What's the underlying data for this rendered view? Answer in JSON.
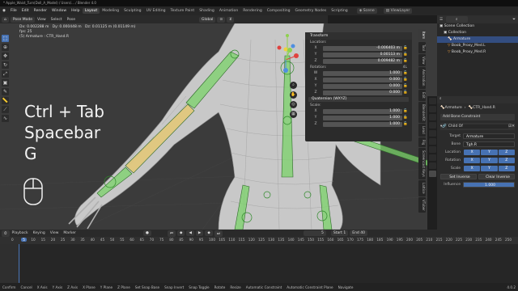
{
  "titlebar": {
    "text": "* Apple_Waist_Turn(Doll_A_Model) / Users/... / Blender 4.0"
  },
  "menubar": {
    "menus": [
      "File",
      "Edit",
      "Render",
      "Window",
      "Help"
    ],
    "workspaces": [
      "Layout",
      "Modeling",
      "Sculpting",
      "UV Editing",
      "Texture Paint",
      "Shading",
      "Animation",
      "Rendering",
      "Compositing",
      "Geometry Nodes",
      "Scripting"
    ],
    "active_workspace": "Layout",
    "scene": "Scene",
    "view_layer": "ViewLayer"
  },
  "viewport_header": {
    "mode": "Pose Mode",
    "menus": [
      "View",
      "Select",
      "Pose"
    ],
    "orientation": "Global"
  },
  "viewport": {
    "info_line1": "Dx: 0.002288 m   Dy: 0.000448 m   Dz: 0.01125 m (0.01149 m)",
    "info_line2": "fps: 25",
    "info_line3": "(5) Armature : CTR_Hand.R"
  },
  "overlay_text": {
    "line1": "Ctrl + Tab",
    "line2": "Spacebar",
    "line3": "G"
  },
  "npanel": {
    "transform_title": "Transform",
    "location_label": "Location:",
    "location": [
      {
        "axis": "X",
        "value": "-0.006403 m"
      },
      {
        "axis": "Y",
        "value": "0.00113 m"
      },
      {
        "axis": "Z",
        "value": "0.009482 m"
      }
    ],
    "rotation_label": "Rotation:",
    "rotation_mode": "4L",
    "rotation": [
      {
        "axis": "W",
        "value": "1.000"
      },
      {
        "axis": "X",
        "value": "0.000"
      },
      {
        "axis": "Y",
        "value": "0.000"
      },
      {
        "axis": "Z",
        "value": "0.000"
      }
    ],
    "rotation_type": "Quaternion (WXYZ)",
    "scale_label": "Scale:",
    "scale": [
      {
        "axis": "X",
        "value": "1.000"
      },
      {
        "axis": "Y",
        "value": "1.000"
      },
      {
        "axis": "Z",
        "value": "1.000"
      }
    ],
    "tabs": [
      "Item",
      "Tool",
      "View",
      "Animation",
      "Edit",
      "BlenderKit",
      "Lead",
      "Rig",
      "Screencast Keys",
      "Lattice",
      "VTuber"
    ]
  },
  "outliner": {
    "items": [
      "Scene Collection",
      "Collection",
      "Armature",
      "Boob_Proxy_Med.L",
      "Boob_Proxy_Med.R"
    ]
  },
  "properties": {
    "breadcrumb_obj": "Armature",
    "breadcrumb_bone": "CTR_Hand.R",
    "add_constraint": "Add Bone Constraint",
    "constraint_name": "Child Of",
    "target_label": "Target",
    "target_value": "Armature",
    "bone_label": "Bone",
    "bone_value": "Tgh.R",
    "location_label": "Location",
    "rotation_label": "Rotation",
    "scale_label": "Scale",
    "axes": [
      "X",
      "Y",
      "Z"
    ],
    "set_inverse": "Set Inverse",
    "clear_inverse": "Clear Inverse",
    "influence_label": "Influence",
    "influence_value": "1.000"
  },
  "timeline": {
    "menus": [
      "Playback",
      "Keying",
      "View",
      "Marker"
    ],
    "current_frame": "5",
    "start_label": "Start",
    "start_value": "1",
    "end_label": "End",
    "end_value": "40",
    "ruler": [
      "0",
      "5",
      "10",
      "15",
      "20",
      "25",
      "30",
      "35",
      "40",
      "45",
      "50",
      "55",
      "60",
      "65",
      "70",
      "75",
      "80",
      "85",
      "90",
      "95",
      "100",
      "105",
      "110",
      "115",
      "120",
      "125",
      "130",
      "135",
      "140",
      "145",
      "150",
      "155",
      "160",
      "165",
      "170",
      "175",
      "180",
      "185",
      "190",
      "195",
      "200",
      "205",
      "210",
      "215",
      "220",
      "225",
      "230",
      "235",
      "240",
      "245",
      "250"
    ]
  },
  "statusbar": {
    "items": [
      "Confirm",
      "Cancel",
      "X Axis",
      "Y Axis",
      "Z Axis",
      "X Plane",
      "Y Plane",
      "Z Plane",
      "Set Snap Base",
      "Snap Invert",
      "Snap Toggle",
      "Rotate",
      "Resize",
      "Automatic Constraint",
      "Automatic Constraint Plane",
      "Navigate"
    ],
    "version": "4.0.2"
  },
  "colors": {
    "accent": "#4772b3",
    "bone_green": "#7bd36a",
    "mesh": "#c9c9c9"
  }
}
